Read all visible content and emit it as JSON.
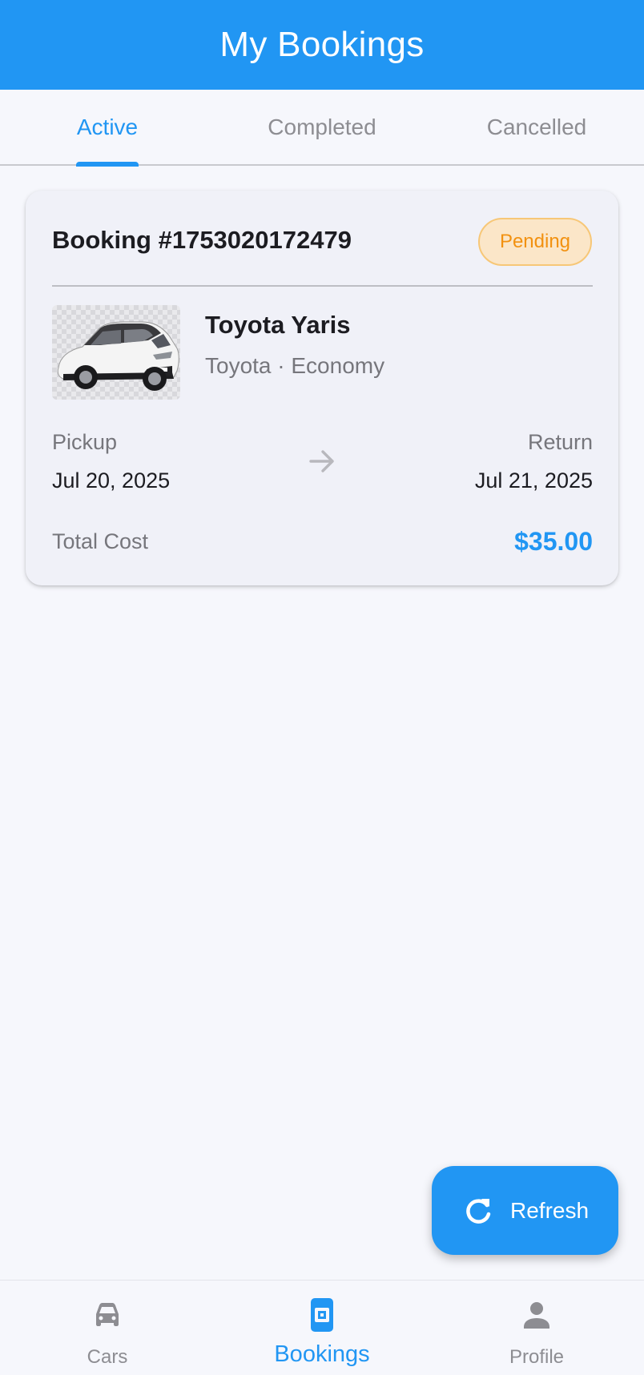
{
  "appbar": {
    "title": "My Bookings"
  },
  "tabs": [
    {
      "label": "Active",
      "active": true
    },
    {
      "label": "Completed",
      "active": false
    },
    {
      "label": "Cancelled",
      "active": false
    }
  ],
  "booking": {
    "id_label": "Booking #1753020172479",
    "status": "Pending",
    "car_name": "Toyota Yaris",
    "car_meta": "Toyota · Economy",
    "pickup_label": "Pickup",
    "pickup_date": "Jul 20, 2025",
    "return_label": "Return",
    "return_date": "Jul 21, 2025",
    "total_label": "Total Cost",
    "total_value": "$35.00",
    "image": "car-photo"
  },
  "fab": {
    "label": "Refresh",
    "icon": "refresh-icon"
  },
  "bottom_nav": [
    {
      "label": "Cars",
      "icon": "car-icon",
      "active": false
    },
    {
      "label": "Bookings",
      "icon": "booking-ticket-icon",
      "active": true
    },
    {
      "label": "Profile",
      "icon": "person-icon",
      "active": false
    }
  ],
  "colors": {
    "primary": "#2196f3",
    "pending_text": "#f29110",
    "pending_bg": "#fbe6c8",
    "pending_border": "#f7c777",
    "inactive": "#8d8d92"
  }
}
